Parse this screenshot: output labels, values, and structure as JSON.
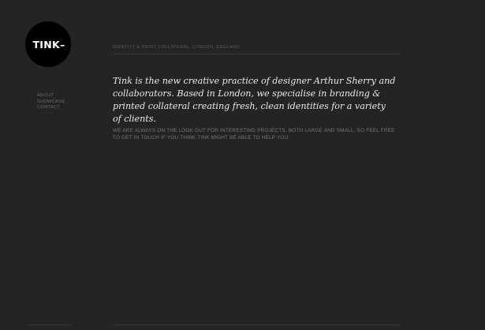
{
  "logo": {
    "text": "TINK–"
  },
  "nav": {
    "items": [
      {
        "label": "ABOUT"
      },
      {
        "label": "SHOWCASE"
      },
      {
        "label": "CONTACT"
      }
    ]
  },
  "header": {
    "tagline": "IDENTITY & PRINT COLLATERAL, LONDON, ENGLAND"
  },
  "main": {
    "intro": "Tink is the new creative practice of designer Arthur Sherry and collaborators. Based in London, we specialise in branding & printed collateral creating fresh, clean identities for a variety of clients.",
    "contact_note": "WE ARE ALWAYS ON THE LOOK OUT FOR INTERESTING PROJECTS, BOTH LARGE AND SMALL, SO FEEL FREE TO GET IN TOUCH IF YOU THINK TINK MIGHT BE ABLE TO HELP YOU."
  },
  "colors": {
    "background": "#242424",
    "logo_circle": "#000000",
    "intro_text": "#e8e8e8",
    "muted_text": "#767676",
    "rule": "#363636"
  }
}
